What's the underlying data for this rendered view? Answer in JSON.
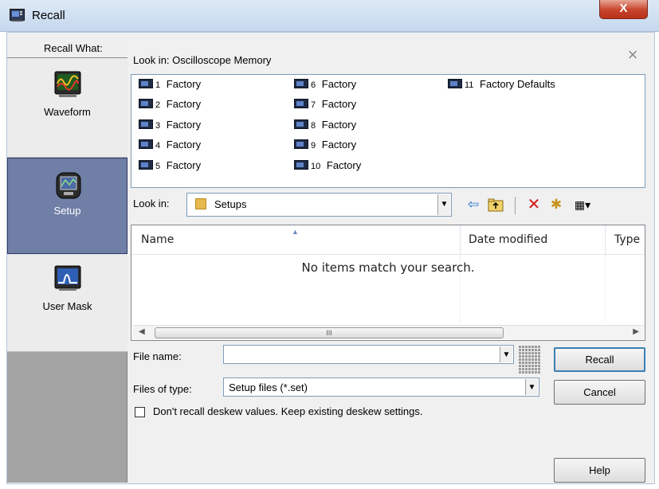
{
  "window": {
    "title": "Recall",
    "close_label": "X"
  },
  "left": {
    "header": "Recall What:",
    "items": [
      {
        "label": "Waveform",
        "icon": "waveform-icon",
        "selected": false
      },
      {
        "label": "Setup",
        "icon": "setup-icon",
        "selected": true
      },
      {
        "label": "User Mask",
        "icon": "user-mask-icon",
        "selected": false
      }
    ]
  },
  "memory": {
    "look_in": "Look in: Oscilloscope Memory",
    "dismiss": "×",
    "items": [
      {
        "num": "1",
        "name": "Factory"
      },
      {
        "num": "2",
        "name": "Factory"
      },
      {
        "num": "3",
        "name": "Factory"
      },
      {
        "num": "4",
        "name": "Factory"
      },
      {
        "num": "5",
        "name": "Factory"
      },
      {
        "num": "6",
        "name": "Factory"
      },
      {
        "num": "7",
        "name": "Factory"
      },
      {
        "num": "8",
        "name": "Factory"
      },
      {
        "num": "9",
        "name": "Factory"
      },
      {
        "num": "10",
        "name": "Factory"
      },
      {
        "num": "11",
        "name": "Factory Defaults"
      }
    ]
  },
  "browser": {
    "look_in_label": "Look in:",
    "folder": "Setups",
    "toolbar": {
      "back": "⇦",
      "up": "⮤",
      "delete": "✕",
      "new_folder": "✱",
      "view": "▦▾"
    },
    "columns": {
      "name": "Name",
      "date": "Date modified",
      "type": "Type"
    },
    "empty": "No items match your search.",
    "scroll_grip": "III"
  },
  "form": {
    "file_name_label": "File name:",
    "file_name_value": "",
    "file_type_label": "Files of type:",
    "file_type_value": "Setup files (*.set)",
    "deskew_label": "Don't recall deskew values. Keep existing deskew settings."
  },
  "buttons": {
    "recall": "Recall",
    "cancel": "Cancel",
    "help": "Help"
  },
  "colors": {
    "selected_nav": "#6f7fa6",
    "close_button": "#c7432a",
    "delete_icon": "#d11a1a"
  }
}
